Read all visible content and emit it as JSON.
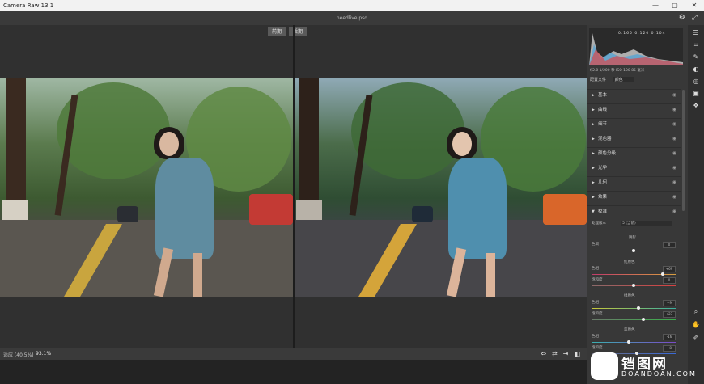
{
  "window": {
    "title": "Camera Raw 13.1",
    "min": "—",
    "max": "▢",
    "close": "✕"
  },
  "doc": {
    "filename": "needlive.psd"
  },
  "view_tabs": [
    "前期",
    "后期"
  ],
  "bottom": {
    "zoom_fit": "适应 (40.5%)",
    "zoom_pct": "93.1%"
  },
  "histogram": {
    "values": "0.165   0.120   0.104"
  },
  "meta": "f/2.0   1/200 秒   ISO 100   85 毫米",
  "profile": {
    "label": "配置文件",
    "value": "颜色"
  },
  "sections": [
    {
      "label": "基本"
    },
    {
      "label": "曲线"
    },
    {
      "label": "细节"
    },
    {
      "label": "混色器"
    },
    {
      "label": "颜色分级"
    },
    {
      "label": "光学"
    },
    {
      "label": "几何"
    },
    {
      "label": "效果"
    },
    {
      "label": "校准"
    }
  ],
  "calibration": {
    "process_label": "处理版本",
    "process_value": "5 (当前)",
    "shadow_title": "阴影",
    "tint_label": "色调",
    "tint_value": "0",
    "red_title": "红原色",
    "red_hue": "+69",
    "red_sat": "0",
    "green_title": "绿原色",
    "green_hue": "+9",
    "green_sat": "+23",
    "blue_title": "蓝原色",
    "blue_hue": "-16",
    "blue_sat": "+8",
    "hue_label": "色相",
    "sat_label": "饱和度"
  },
  "watermark": {
    "brand": "铛图网",
    "site": "DOANDOAN.COM"
  },
  "colors": {
    "accent": "#5f8ca0",
    "panel": "#383838",
    "canvas": "#303030"
  }
}
